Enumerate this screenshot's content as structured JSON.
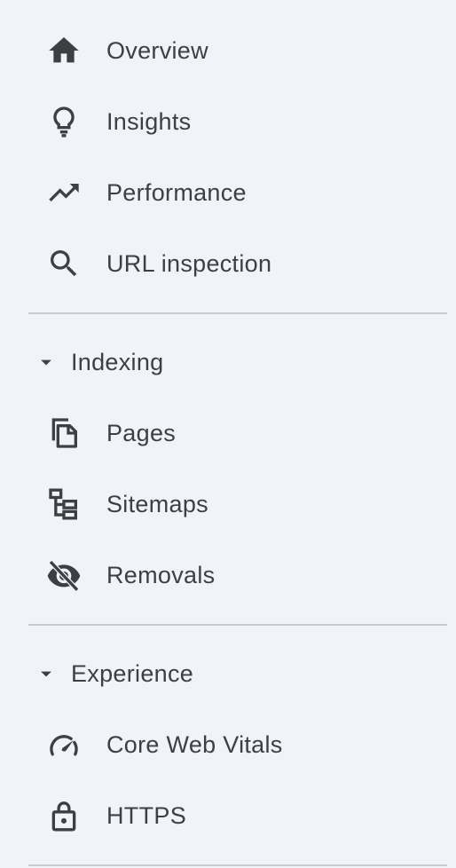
{
  "nav": {
    "top_items": [
      {
        "label": "Overview",
        "icon": "home-icon"
      },
      {
        "label": "Insights",
        "icon": "lightbulb-icon"
      },
      {
        "label": "Performance",
        "icon": "trending-up-icon"
      },
      {
        "label": "URL inspection",
        "icon": "search-icon"
      }
    ],
    "indexing": {
      "title": "Indexing",
      "items": [
        {
          "label": "Pages",
          "icon": "pages-icon"
        },
        {
          "label": "Sitemaps",
          "icon": "sitemap-icon"
        },
        {
          "label": "Removals",
          "icon": "visibility-off-icon"
        }
      ]
    },
    "experience": {
      "title": "Experience",
      "items": [
        {
          "label": "Core Web Vitals",
          "icon": "speed-gauge-icon"
        },
        {
          "label": "HTTPS",
          "icon": "lock-icon"
        }
      ]
    }
  },
  "colors": {
    "background": "#f0f4f9",
    "text": "#3c4043",
    "divider": "#c7ccd1"
  }
}
